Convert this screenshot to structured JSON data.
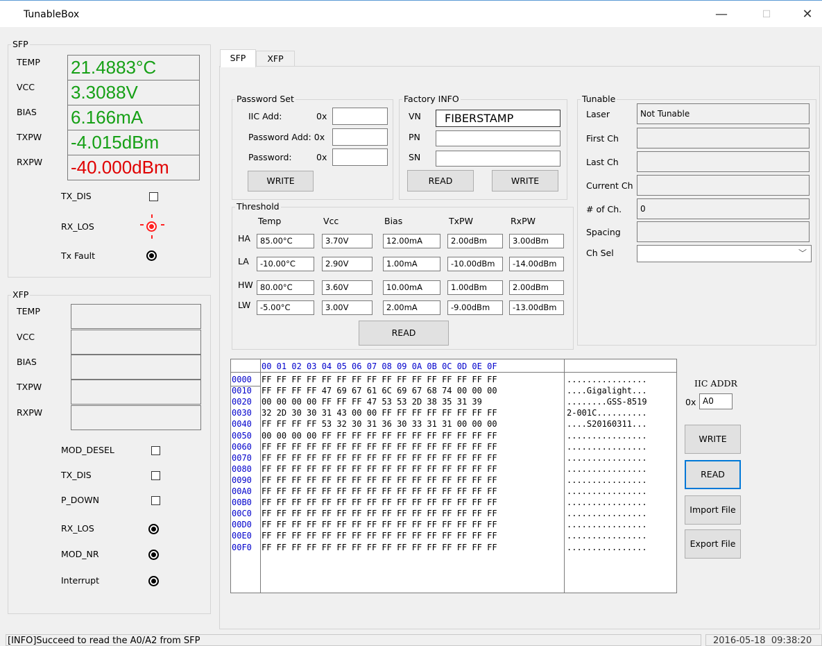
{
  "window": {
    "title": "TunableBox",
    "minimize": "—",
    "maximize": "☐",
    "close": "✕"
  },
  "sfp_panel": {
    "title": "SFP",
    "readings": [
      {
        "label": "TEMP",
        "value": "21.4883°C",
        "color": "#16a016"
      },
      {
        "label": "VCC",
        "value": "3.3088V",
        "color": "#16a016"
      },
      {
        "label": "BIAS",
        "value": "6.166mA",
        "color": "#16a016"
      },
      {
        "label": "TXPW",
        "value": "-4.015dBm",
        "color": "#16a016"
      },
      {
        "label": "RXPW",
        "value": "-40.000dBm",
        "color": "#e00000"
      }
    ],
    "tx_dis": "TX_DIS",
    "rx_los": "RX_LOS",
    "tx_fault": "Tx Fault"
  },
  "xfp_panel": {
    "title": "XFP",
    "readings": [
      "TEMP",
      "VCC",
      "BIAS",
      "TXPW",
      "RXPW"
    ],
    "mod_desel": "MOD_DESEL",
    "tx_dis": "TX_DIS",
    "p_down": "P_DOWN",
    "rx_los": "RX_LOS",
    "mod_nr": "MOD_NR",
    "interrupt": "Interrupt"
  },
  "tabs": [
    "SFP",
    "XFP"
  ],
  "password_set": {
    "title": "Password Set",
    "iic_add": "IIC Add:",
    "password_add": "Password Add: 0x",
    "password": "Password:",
    "prefix": "0x",
    "write": "WRITE"
  },
  "factory_info": {
    "title": "Factory INFO",
    "vn_label": "VN",
    "vn_value": "FIBERSTAMP",
    "pn_label": "PN",
    "sn_label": "SN",
    "read": "READ",
    "write": "WRITE"
  },
  "threshold": {
    "title": "Threshold",
    "columns": [
      "Temp",
      "Vcc",
      "Bias",
      "TxPW",
      "RxPW"
    ],
    "rows": [
      {
        "label": "HA",
        "values": [
          "85.00°C",
          "3.70V",
          "12.00mA",
          "2.00dBm",
          "3.00dBm"
        ]
      },
      {
        "label": "LA",
        "values": [
          "-10.00°C",
          "2.90V",
          "1.00mA",
          "-10.00dBm",
          "-14.00dBm"
        ]
      },
      {
        "label": "HW",
        "values": [
          "80.00°C",
          "3.60V",
          "10.00mA",
          "1.00dBm",
          "2.00dBm"
        ]
      },
      {
        "label": "LW",
        "values": [
          "-5.00°C",
          "3.00V",
          "2.00mA",
          "-9.00dBm",
          "-13.00dBm"
        ]
      }
    ],
    "read": "READ"
  },
  "tunable": {
    "title": "Tunable",
    "fields": [
      {
        "label": "Laser",
        "value": "Not Tunable"
      },
      {
        "label": "First Ch",
        "value": ""
      },
      {
        "label": "Last Ch",
        "value": ""
      },
      {
        "label": "Current Ch",
        "value": ""
      },
      {
        "label": "# of Ch.",
        "value": "0"
      },
      {
        "label": "Spacing",
        "value": ""
      }
    ],
    "ch_sel_label": "Ch Sel",
    "ch_sel_value": "",
    "chevron": "﹀"
  },
  "hex": {
    "header": "00 01 02 03 04 05 06 07 08 09 0A 0B 0C 0D 0E 0F",
    "rows": [
      {
        "addr": "0000",
        "bytes": "FF FF FF FF FF FF FF FF FF FF FF FF FF FF FF FF",
        "ascii": "................"
      },
      {
        "addr": "0010",
        "bytes": "FF FF FF FF 47 69 67 61 6C 69 67 68 74 00 00 00",
        "ascii": "....Gigalight..."
      },
      {
        "addr": "0020",
        "bytes": "00 00 00 00 FF FF FF 47 53 53 2D 38 35 31 39",
        "ascii": "........GSS-8519"
      },
      {
        "addr": "0030",
        "bytes": "32 2D 30 30 31 43 00 00 FF FF FF FF FF FF FF FF",
        "ascii": "2-001C.........."
      },
      {
        "addr": "0040",
        "bytes": "FF FF FF FF 53 32 30 31 36 30 33 31 31 00 00 00",
        "ascii": "....S20160311..."
      },
      {
        "addr": "0050",
        "bytes": "00 00 00 00 FF FF FF FF FF FF FF FF FF FF FF FF",
        "ascii": "................"
      },
      {
        "addr": "0060",
        "bytes": "FF FF FF FF FF FF FF FF FF FF FF FF FF FF FF FF",
        "ascii": "................"
      },
      {
        "addr": "0070",
        "bytes": "FF FF FF FF FF FF FF FF FF FF FF FF FF FF FF FF",
        "ascii": "................"
      },
      {
        "addr": "0080",
        "bytes": "FF FF FF FF FF FF FF FF FF FF FF FF FF FF FF FF",
        "ascii": "................"
      },
      {
        "addr": "0090",
        "bytes": "FF FF FF FF FF FF FF FF FF FF FF FF FF FF FF FF",
        "ascii": "................"
      },
      {
        "addr": "00A0",
        "bytes": "FF FF FF FF FF FF FF FF FF FF FF FF FF FF FF FF",
        "ascii": "................"
      },
      {
        "addr": "00B0",
        "bytes": "FF FF FF FF FF FF FF FF FF FF FF FF FF FF FF FF",
        "ascii": "................"
      },
      {
        "addr": "00C0",
        "bytes": "FF FF FF FF FF FF FF FF FF FF FF FF FF FF FF FF",
        "ascii": "................"
      },
      {
        "addr": "00D0",
        "bytes": "FF FF FF FF FF FF FF FF FF FF FF FF FF FF FF FF",
        "ascii": "................"
      },
      {
        "addr": "00E0",
        "bytes": "FF FF FF FF FF FF FF FF FF FF FF FF FF FF FF FF",
        "ascii": "................"
      },
      {
        "addr": "00F0",
        "bytes": "FF FF FF FF FF FF FF FF FF FF FF FF FF FF FF FF",
        "ascii": "................"
      }
    ]
  },
  "iic": {
    "label": "IIC ADDR",
    "prefix": "0x",
    "value": "A0"
  },
  "actions": {
    "write": "WRITE",
    "read": "READ",
    "import": "Import File",
    "export": "Export File"
  },
  "status": {
    "message": "[INFO]Succeed to read the A0/A2 from SFP",
    "date": "2016-05-18",
    "time": "09:38:20"
  }
}
